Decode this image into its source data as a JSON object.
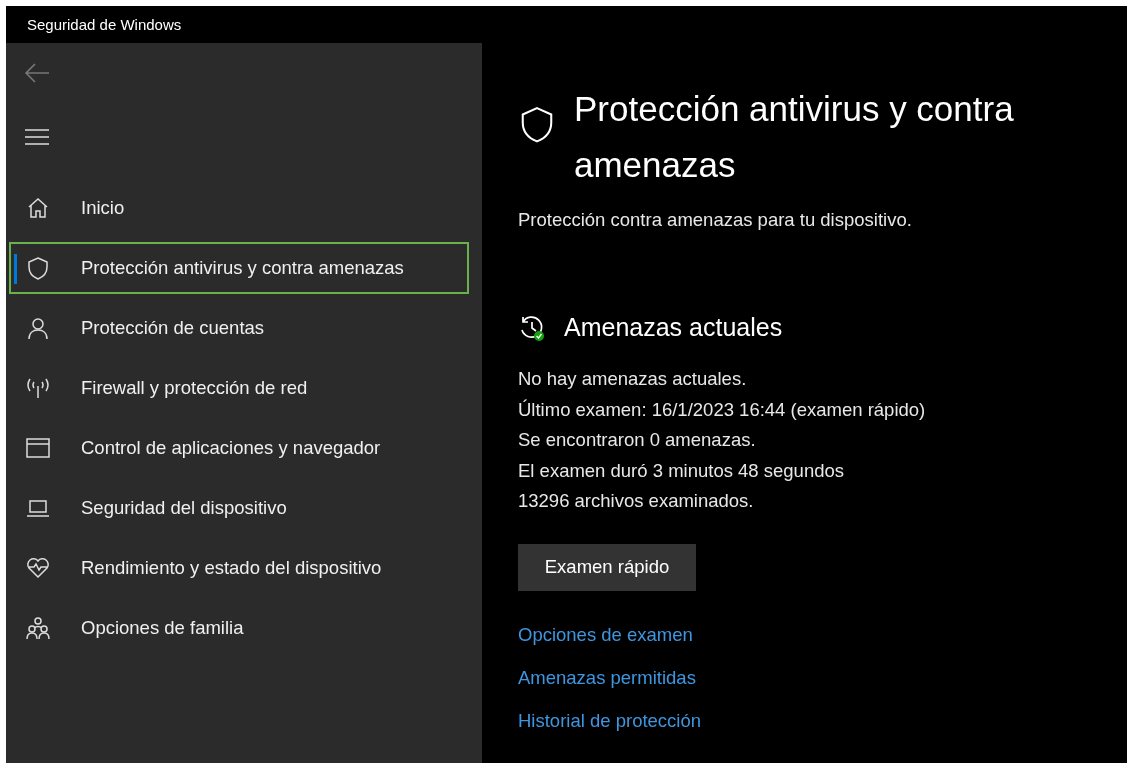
{
  "window": {
    "title": "Seguridad de Windows"
  },
  "sidebar": {
    "items": [
      {
        "label": "Inicio",
        "selected": false
      },
      {
        "label": "Protección antivirus y contra amenazas",
        "selected": true
      },
      {
        "label": "Protección de cuentas",
        "selected": false
      },
      {
        "label": "Firewall y protección de red",
        "selected": false
      },
      {
        "label": "Control de aplicaciones y navegador",
        "selected": false
      },
      {
        "label": "Seguridad del dispositivo",
        "selected": false
      },
      {
        "label": "Rendimiento y estado del dispositivo",
        "selected": false
      },
      {
        "label": "Opciones de familia",
        "selected": false
      }
    ]
  },
  "page": {
    "title": "Protección antivirus y contra amenazas",
    "subtitle": "Protección contra amenazas para tu dispositivo.",
    "section": {
      "title": "Amenazas actuales",
      "lines": [
        "No hay amenazas actuales.",
        "Último examen: 16/1/2023 16:44 (examen rápido)",
        "Se encontraron 0 amenazas.",
        "El examen duró 3 minutos 48 segundos",
        "13296 archivos examinados."
      ],
      "button": "Examen rápido",
      "links": [
        "Opciones de examen",
        "Amenazas permitidas",
        "Historial de protección"
      ]
    }
  }
}
